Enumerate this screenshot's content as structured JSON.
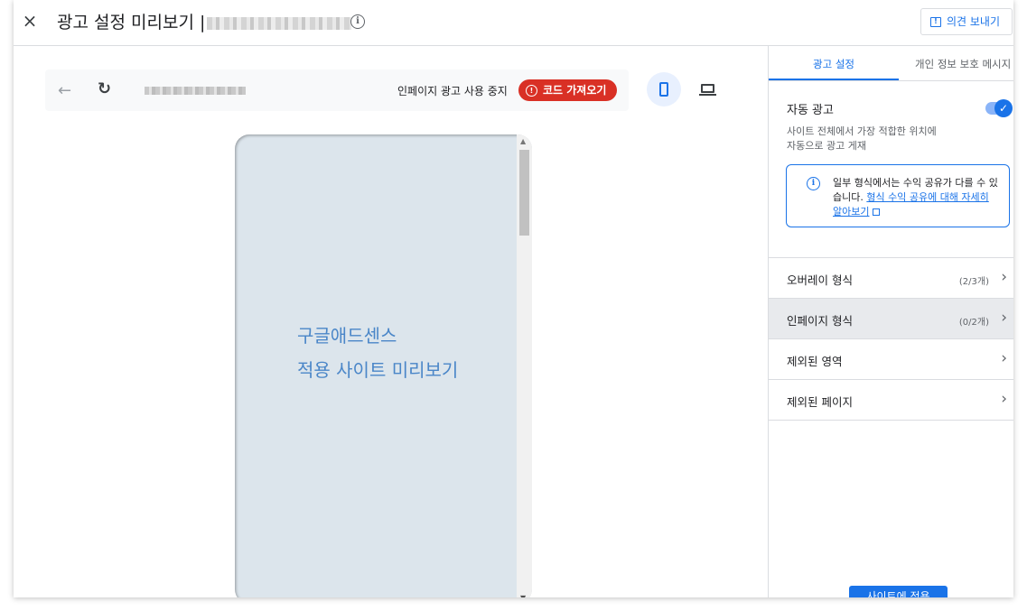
{
  "header": {
    "title": "광고 설정 미리보기 |",
    "close_icon": "×",
    "info_icon": "i",
    "feedback_label": "의견 보내기",
    "feedback_icon": "!"
  },
  "preview": {
    "back_icon": "←",
    "reload_icon": "↻",
    "stop_label": "인페이지 광고 사용 중지",
    "get_code_label": "코드 가져오기",
    "alert_icon": "!",
    "line1": "구글애드센스",
    "line2": "적용 사이트 미리보기",
    "scroll_up": "▲",
    "scroll_down": "▼"
  },
  "panel": {
    "tabs": [
      {
        "label": "광고 설정"
      },
      {
        "label": "개인 정보 보호 메시지"
      }
    ],
    "auto_ads": {
      "title": "자동 광고",
      "toggle_check": "✓",
      "desc_line1": "사이트 전체에서 가장 적합한 위치에",
      "desc_line2": "자동으로 광고 게재"
    },
    "notice": {
      "text": "일부 형식에서는 수익 공유가 다를 수 있습니다. ",
      "link": "형식 수익 공유에 대해 자세히 알아보기"
    },
    "rows": [
      {
        "label": "오버레이 형식",
        "count": "(2/3개)",
        "chevron": "›"
      },
      {
        "label": "인페이지 형식",
        "count": "(0/2개)",
        "chevron": "›"
      },
      {
        "label": "제외된 영역",
        "count": "",
        "chevron": "›"
      },
      {
        "label": "제외된 페이지",
        "count": "",
        "chevron": "›"
      }
    ],
    "apply_label": "사이트에 적용"
  },
  "colors": {
    "accent": "#1a73e8",
    "danger": "#d93025",
    "preview_text": "#4a86c8"
  }
}
